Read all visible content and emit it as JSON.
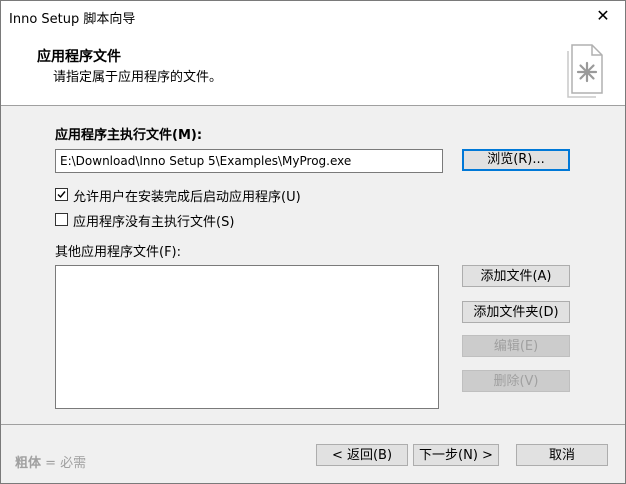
{
  "window": {
    "title": "Inno Setup 脚本向导",
    "close_glyph": "✕"
  },
  "header": {
    "title": "应用程序文件",
    "subtitle": "请指定属于应用程序的文件。",
    "icon": "document-icon"
  },
  "main_exe": {
    "label": "应用程序主执行文件(M):",
    "path_value": "E:\\Download\\Inno Setup 5\\Examples\\MyProg.exe",
    "browse_label": "浏览(R)..."
  },
  "options": [
    {
      "label": "允许用户在安装完成后启动应用程序(U)",
      "checked": true
    },
    {
      "label": "应用程序没有主执行文件(S)",
      "checked": false
    }
  ],
  "other_files": {
    "label": "其他应用程序文件(F):",
    "buttons": [
      {
        "label": "添加文件(A)",
        "enabled": true
      },
      {
        "label": "添加文件夹(D)",
        "enabled": true
      },
      {
        "label": "编辑(E)",
        "enabled": false
      },
      {
        "label": "删除(V)",
        "enabled": false
      }
    ]
  },
  "footer": {
    "legend_bold": "粗体",
    "legend_rest": " = 必需",
    "back_label": "< 返回(B)",
    "next_label": "下一步(N) >",
    "cancel_label": "取消"
  }
}
